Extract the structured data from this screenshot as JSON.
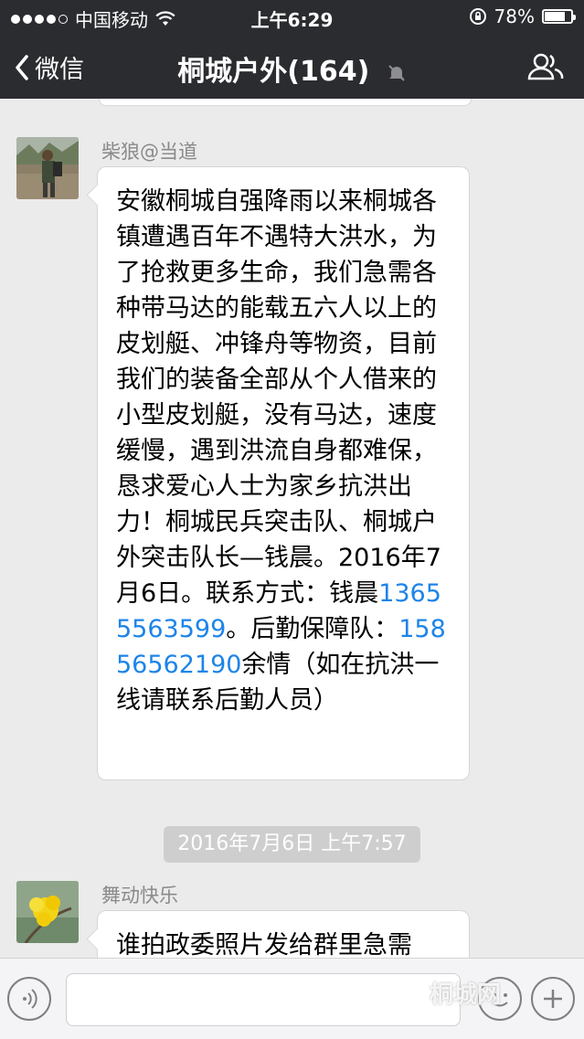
{
  "status_bar": {
    "carrier": "中国移动",
    "time": "上午6:29",
    "battery_percent": "78%",
    "battery_level": 0.78
  },
  "nav": {
    "back_label": "微信",
    "title": "桐城户外(164)"
  },
  "messages": [
    {
      "sender": "柴狼@当道",
      "segments": [
        {
          "text": "安徽桐城自强降雨以来桐城各镇遭遇百年不遇特大洪水，为了抢救更多生命，我们急需各种带马达的能载五六人以上的皮划艇、冲锋舟等物资，目前我们的装备全部从个人借来的小型皮划艇，没有马达，速度缓慢，遇到洪流自身都难保，恳求爱心人士为家乡抗洪出力！桐城民兵突击队、桐城户外突击队长—钱晨。2016年7月6日。联系方式：钱晨"
        },
        {
          "text": "13655563599",
          "link": true
        },
        {
          "text": "。后勤保障队："
        },
        {
          "text": "15856562190",
          "link": true
        },
        {
          "text": "余情（如在抗洪一线请联系后勤人员）"
        }
      ]
    },
    {
      "sender": "舞动快乐",
      "segments": [
        {
          "text": "谁拍政委照片发给群里急需"
        }
      ]
    }
  ],
  "timestamp": "2016年7月6日 上午7:57",
  "watermark": "桐城网",
  "colors": {
    "bar_bg": "#2b2c30",
    "chat_bg": "#ebebeb",
    "link": "#1d84e8"
  }
}
